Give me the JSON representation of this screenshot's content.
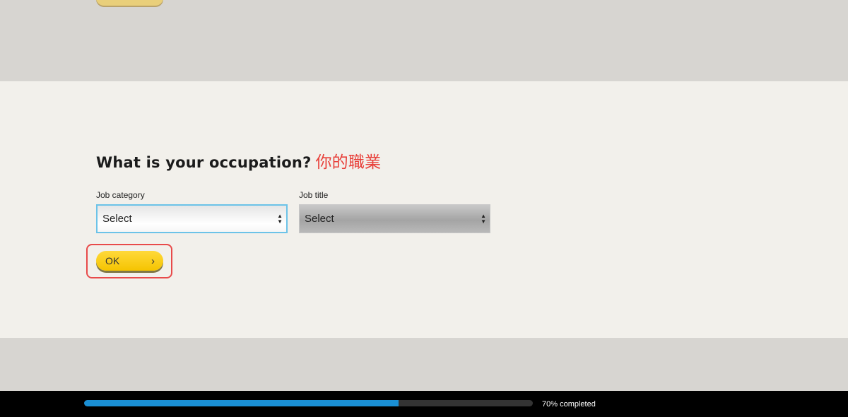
{
  "question": {
    "title": "What is your occupation?",
    "annotation": "你的職業"
  },
  "fields": {
    "job_category": {
      "label": "Job category",
      "value": "Select"
    },
    "job_title": {
      "label": "Job title",
      "value": "Select"
    }
  },
  "ok_button": {
    "label": "OK",
    "icon": "chevron-right-icon"
  },
  "progress": {
    "percent": 70,
    "label": "70% completed"
  },
  "colors": {
    "button_yellow": "#f5c400",
    "progress_blue": "#1a8fd4",
    "highlight_red": "#e84a4a",
    "annotation_red": "#e8403a",
    "focus_blue": "#6cc3e8"
  }
}
